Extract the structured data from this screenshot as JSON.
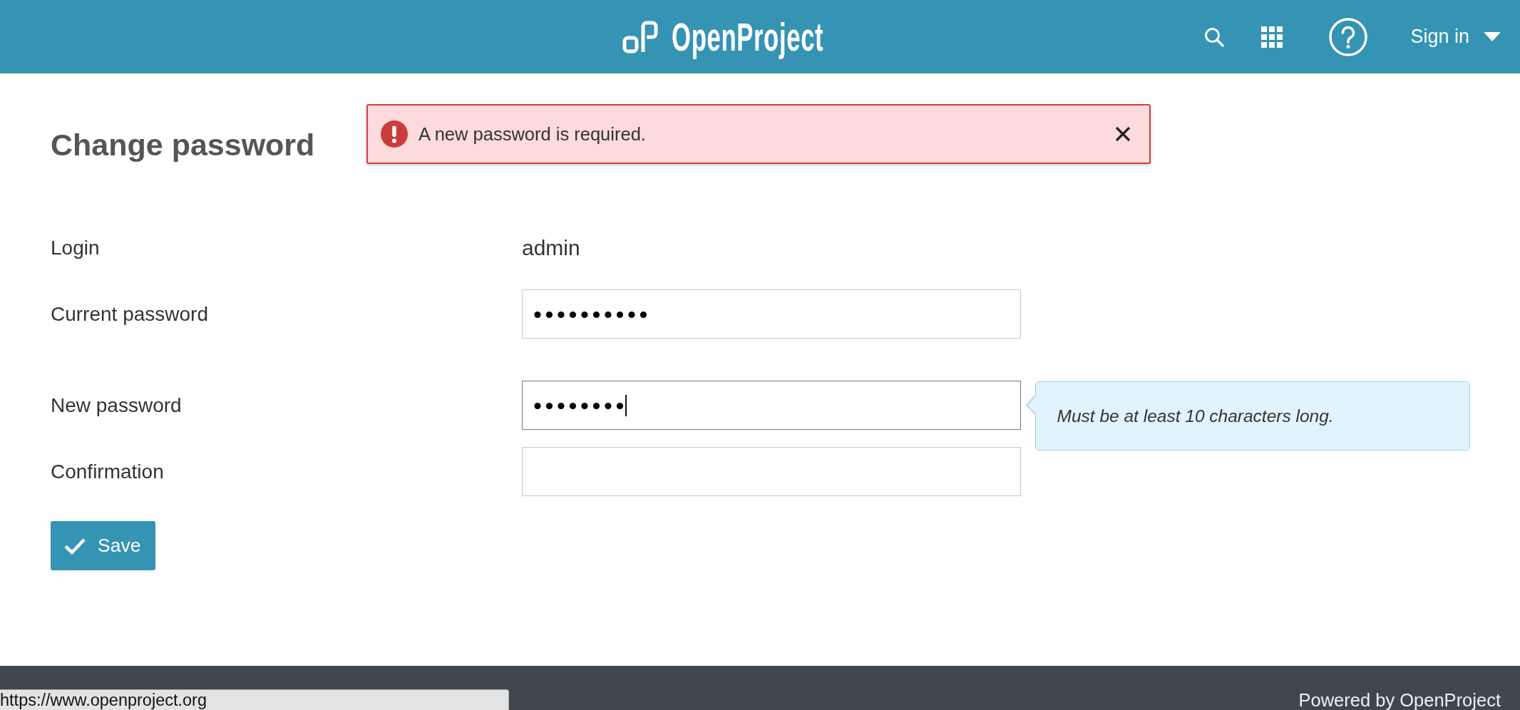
{
  "header": {
    "logo": "OpenProject",
    "sign_in": "Sign in"
  },
  "alert": {
    "message": "A new password is required."
  },
  "page": {
    "title": "Change password"
  },
  "form": {
    "groups": [
      {
        "fields": [
          {
            "kind": "static",
            "label": "Login",
            "value": "admin"
          },
          {
            "kind": "password",
            "label": "Current password",
            "value": "••••••••••",
            "focused": false
          }
        ]
      },
      {
        "fields": [
          {
            "kind": "password",
            "label": "New password",
            "value": "••••••••",
            "focused": true,
            "hint": "Must be at least 10 characters long."
          },
          {
            "kind": "password",
            "label": "Confirmation",
            "focused": false
          }
        ]
      }
    ],
    "submit": "Save"
  },
  "footer": {
    "text": "Powered by OpenProject"
  },
  "browser_status": {
    "url": "https://www.openproject.org"
  }
}
